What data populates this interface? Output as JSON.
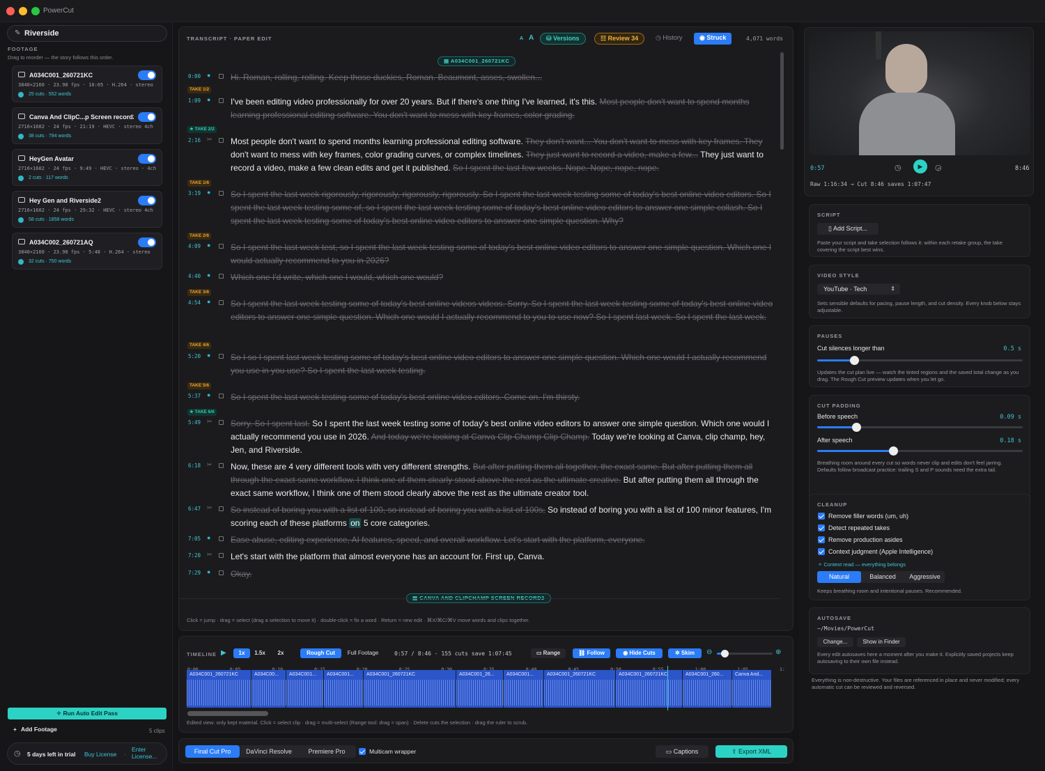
{
  "app": {
    "title": "PowerCut"
  },
  "left": {
    "project": "Riverside",
    "footage_label": "FOOTAGE",
    "footage_hint": "Drag to reorder — the story follows this order.",
    "clips": [
      {
        "name": "A034C001_260721KC",
        "meta": "3840×2160 · 23.98 fps · 10:05 · H.264 · stereo",
        "stat": "25 cuts · 552 words"
      },
      {
        "name": "Canva And ClipC...p Screen record2",
        "meta": "2716×1602 · 24 fps · 21:19 · HEVC · stereo 4ch",
        "stat": "38 cuts · 794 words"
      },
      {
        "name": "HeyGen Avatar",
        "meta": "2716×1602 · 24 fps · 9:49 · HEVC · stereo · 4ch",
        "stat": "2 cuts · 117 words"
      },
      {
        "name": "Hey Gen and Riverside2",
        "meta": "2716×1602 · 24 fps · 29:32 · HEVC · stereo 4ch",
        "stat": "58 cuts · 1858 words"
      },
      {
        "name": "A034C002_260721AQ",
        "meta": "3840×2160 · 23.98 fps · 5:48 · H.264 · stereo",
        "stat": "32 cuts · 750 words"
      }
    ],
    "run_auto": "Run Auto Edit Pass",
    "add_footage": "Add Footage",
    "clip_count": "5 clips",
    "trial": "5 days left in trial",
    "buy": "Buy License",
    "sep": "·",
    "enter1": "Enter",
    "enter2": "License..."
  },
  "transcript": {
    "header": "TRANSCRIPT · PAPER EDIT",
    "font_a_small": "A",
    "font_a_large": "A",
    "versions": "Versions",
    "review": "Review 34",
    "history": "History",
    "struck": "Struck",
    "words": "4,071 words",
    "banner1": "A034C001_260721KC",
    "banner2": "CANVA AND CLIPCHAMP SCREEN RECORD2",
    "footer": "Click = jump · drag = select (drag a selection to move it) · double-click = fix a word · Return = new edit · ⌘X/⌘C/⌘V move words and clips together.",
    "rows": [
      {
        "ts": "0:00",
        "take": "",
        "cut": true,
        "text": "Hi. Roman, rolling, rolling. Keep those duckies, Roman. Beaumont, asses, swollen..."
      },
      {
        "ts": "1:09",
        "take": "TAKE 1/2",
        "kept": "I've been editing video professionally for over 20 years. But if there's one thing I've learned, it's this.",
        "struck": "Most people don't want to spend months learning professional editing software. You don't want to mess with key frames, color grading."
      },
      {
        "ts": "2:16",
        "take": "★ TAKE 2/2",
        "p1": "Most people don't want to spend months learning professional editing software.",
        "s1": "They don't want... You don't want to mess with key frames. They",
        "p2": "don't want to mess with key frames, color grading curves, or complex timelines.",
        "s2": "They just want to record a video, make a few...",
        "p3": "They just want to record a video, make a few clean edits and get it published.",
        "s3": "So I spent the last few weeks. Nope. Nope, nope, nope."
      },
      {
        "ts": "3:19",
        "take": "TAKE 1/6",
        "cut": true,
        "text": "So I spent the last week rigorously, rigorously, rigorously, rigorously. So I spent the last week testing some of today's best online video editors. So I spent the last week testing some of, so I spent the last week testing some of today's best online video editors to answer one simple collash. So I spent the last week testing some of today's best online video editors to answer one simple question. Why?"
      },
      {
        "ts": "4:09",
        "take": "TAKE 2/6",
        "cut": true,
        "text": "So I spent the last week test, so I spent the last week testing some of today's best online video editors to answer one simple question. Which one I would actually recommend to you in 2026?"
      },
      {
        "ts": "4:40",
        "take": "",
        "cut": true,
        "text": "Which one I'd write, which one I would, which one would?"
      },
      {
        "ts": "4:54",
        "take": "TAKE 3/6",
        "cut": true,
        "text": "So I spent the last week testing some of today's best online videos videos. Sorry. So I spent the last week testing some of today's best online video editors to answer one simple question. Which one would I actually recommend to you to use now? So I spent last week. So I spent the last week."
      },
      {
        "ts": "5:20",
        "take": "TAKE 4/6",
        "cut": true,
        "text": "So I so I spent last week testing some of today's best online video editors to answer one simple question. Which one would I actually recommend you use in you use? So I spent the last week testing."
      },
      {
        "ts": "5:37",
        "take": "TAKE 5/6",
        "cut": true,
        "text": "So I spent the last week testing some of today's best online video editors. Come on. I'm thirsty."
      },
      {
        "ts": "5:49",
        "take": "★ TAKE 6/6",
        "s1": "Sorry. So I spent last.",
        "p1": "So I spent the last week testing some of today's best online video editors to answer one simple question. Which one would I actually recommend you use in 2026.",
        "s2": "And today we're looking at Canva Clip Champ Clip Champ.",
        "p2": "Today we're looking at Canva, clip champ, hey, Jen, and Riverside."
      },
      {
        "ts": "6:18",
        "take": "",
        "p1": "Now, these are 4 very different tools with very different strengths.",
        "s1": "But after putting them all together, the exact same. But after putting them all through the exact same workflow. I think one of them clearly stood above the rest as the ultimate creative.",
        "p2": "But after putting them all through the exact same workflow, I think one of them stood clearly above the rest as the ultimate creator tool."
      },
      {
        "ts": "6:47",
        "take": "",
        "s1": "So instead of boring you with a list of 100, so instead of boring you with a list of 100s,",
        "p1": "So instead of boring you with a list of 100 minor features, I'm scoring each of these platforms",
        "hl": "on",
        "p2": "5 core categories."
      },
      {
        "ts": "7:05",
        "take": "",
        "cut": true,
        "text": "Ease abuse, editing experience, AI features, speed, and overall workflow. Let's start with the platform, everyone."
      },
      {
        "ts": "7:20",
        "take": "",
        "cut": false,
        "text": "Let's start with the platform that almost everyone has an account for. First up, Canva."
      },
      {
        "ts": "7:29",
        "take": "",
        "cut": true,
        "text": "Okay."
      }
    ]
  },
  "timeline": {
    "label": "TIMELINE",
    "speeds": [
      "1x",
      "1.5x",
      "2x"
    ],
    "rough_cut": "Rough Cut",
    "full_footage": "Full Footage",
    "status": "0:57 / 8:46 · 155 cuts save 1:07:45",
    "range": "Range",
    "follow": "Follow",
    "hide_cuts": "Hide Cuts",
    "skim": "Skim",
    "zoom": 0.08,
    "ruler": [
      "0:00",
      "0:05",
      "0:10",
      "0:15",
      "0:20",
      "0:25",
      "0:30",
      "0:35",
      "0:40",
      "0:45",
      "0:50",
      "0:55",
      "1:00",
      "1:05",
      "1:"
    ],
    "segments": [
      "A034C001_260721KC",
      "A034C00...",
      "A034C001...",
      "A034C001...",
      "A034C001_260721KC",
      "A034C001_26...",
      "A034C001...",
      "A034C001_260721KC",
      "A034C001_260721KC",
      "A034C001_260...",
      "Canva And..."
    ],
    "footer": "Edited view: only kept material. Click = select clip · drag = multi-select (Range tool: drag = span) · Delete cuts the selection · drag the ruler to scrub."
  },
  "export": {
    "targets": [
      "Final Cut Pro",
      "DaVinci Resolve",
      "Premiere Pro"
    ],
    "multicam": "Multicam wrapper",
    "captions": "Captions",
    "export_xml": "Export XML"
  },
  "right": {
    "time_now": "0:57",
    "time_total": "8:46",
    "raw_line": "Raw 1:16:34 → Cut 8:46 saves 1:07:47",
    "script_label": "SCRIPT",
    "add_script": "Add Script...",
    "script_desc": "Paste your script and take selection follows it: within each retake group, the take covering the script best wins.",
    "style_label": "VIDEO STYLE",
    "style_value": "YouTube · Tech",
    "style_desc": "Sets sensible defaults for pacing, pause length, and cut density. Every knob below stays adjustable.",
    "pauses_label": "PAUSES",
    "pauses_name": "Cut silences longer than",
    "pauses_value": "0.5 s",
    "pauses_level": 0.18,
    "pauses_desc": "Updates the cut plan live — watch the tinted regions and the saved total change as you drag. The Rough Cut preview updates when you let go.",
    "padding_label": "CUT PADDING",
    "before_name": "Before speech",
    "before_value": "0.09 s",
    "before_level": 0.19,
    "after_name": "After speech",
    "after_value": "0.18 s",
    "after_level": 0.37,
    "padding_desc": "Breathing room around every cut so words never clip and edits don't feel jarring. Defaults follow broadcast practice: trailing S and P sounds need the extra tail.",
    "cleanup_label": "CLEANUP",
    "cleanup": [
      "Remove filler words (um, uh)",
      "Detect repeated takes",
      "Remove production asides",
      "Context judgment (Apple Intelligence)"
    ],
    "context_note": "Context read — everything belongs",
    "modes": [
      "Natural",
      "Balanced",
      "Aggressive"
    ],
    "mode_desc": "Keeps breathing room and intentional pauses. Recommended.",
    "autosave_label": "AUTOSAVE",
    "autosave_path": "~/Movies/PowerCut",
    "change": "Change...",
    "finder": "Show in Finder",
    "autosave_desc": "Every edit autosaves here a moment after you make it. Explicitly saved projects keep autosaving to their own file instead.",
    "footer": "Everything is non-destructive. Your files are referenced in place and never modified; every automatic cut can be reviewed and reversed."
  },
  "colors": {
    "accent": "#2b7cf6",
    "teal": "#2cd3c5",
    "take_orange": "#e5a23a"
  }
}
